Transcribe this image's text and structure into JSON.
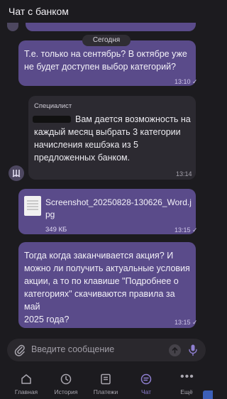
{
  "header": {
    "title": "Чат с банком"
  },
  "date_separator": "Сегодня",
  "messages": [
    {
      "text_lines": [
        "Т.е. только на сентябрь? В октябре уже",
        "не будет доступен выбор категорий?"
      ],
      "time": "13:10"
    },
    {
      "sender": "Специалист",
      "text_lines": [
        "Вам дается возможность на",
        "каждый месяц выбрать 3 категории",
        "начисления кешбэка из 5",
        "предложенных банком."
      ],
      "time": "13:14"
    },
    {
      "file": {
        "name_lines": [
          "Screenshot_20250828-130626_Word.j",
          "pg"
        ],
        "size": "349 КБ"
      },
      "time": "13:15"
    },
    {
      "text_lines": [
        "Тогда когда заканчивается акция? И",
        "можно ли получить актуальные условия",
        "акции, а то по клавише \"Подробнее о",
        "категориях\" скачиваются правила за май",
        "2025 года?"
      ],
      "time": "13:15"
    }
  ],
  "input": {
    "placeholder": "Введите сообщение"
  },
  "nav": {
    "items": [
      {
        "label": "Главная",
        "icon": "home-icon"
      },
      {
        "label": "История",
        "icon": "clock-icon"
      },
      {
        "label": "Платежи",
        "icon": "payments-icon"
      },
      {
        "label": "Чат",
        "icon": "chat-icon"
      },
      {
        "label": "Ещё",
        "icon": "more-icon"
      }
    ],
    "active": "Чат"
  },
  "colors": {
    "background": "#1c1b1f",
    "outgoing_bubble": "#5a4b8a",
    "incoming_bubble": "#2c2a31",
    "accent": "#8f7fd1"
  }
}
